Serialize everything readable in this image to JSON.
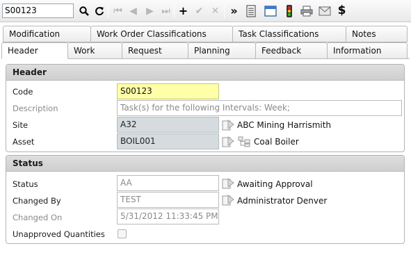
{
  "toolbar": {
    "search_value": "S00123",
    "icons": [
      "search-icon",
      "refresh-icon",
      "first-record-icon",
      "previous-record-icon",
      "next-record-icon",
      "last-record-icon",
      "add-icon",
      "save-icon",
      "cancel-icon",
      "more-actions-icon",
      "list-view-icon",
      "window-icon",
      "traffic-light-icon",
      "print-icon",
      "email-icon",
      "cost-icon"
    ]
  },
  "tabs": {
    "row1": [
      "Modification",
      "Work Order Classifications",
      "Task Classifications",
      "Notes"
    ],
    "row2": [
      "Header",
      "Work",
      "Request",
      "Planning",
      "Feedback",
      "Information"
    ],
    "active": "Header"
  },
  "header_section": {
    "title": "Header",
    "code_label": "Code",
    "code_value": "S00123",
    "description_label": "Description",
    "description_value": "Task(s) for the following Intervals: Week;",
    "site_label": "Site",
    "site_value": "A32",
    "site_name": "ABC Mining Harrismith",
    "asset_label": "Asset",
    "asset_value": "BOIL001",
    "asset_name": "Coal Boiler"
  },
  "status_section": {
    "title": "Status",
    "status_label": "Status",
    "status_value": "AA",
    "status_name": "Awaiting Approval",
    "changed_by_label": "Changed By",
    "changed_by_value": "TEST",
    "changed_by_name": "Administrator Denver",
    "changed_on_label": "Changed On",
    "changed_on_value": "5/31/2012 11:33:45 PM",
    "unapproved_label": "Unapproved Quantities",
    "unapproved_checked": false
  }
}
